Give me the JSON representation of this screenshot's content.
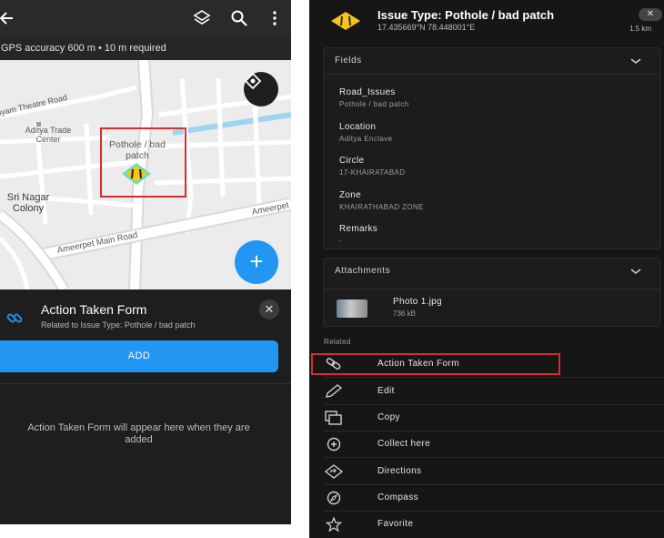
{
  "left": {
    "gps_text": "GPS accuracy 600 m • 10 m required",
    "map_labels": {
      "theatre_road": "iyam Theatre Road",
      "trade_center": "Aditya Trade Center",
      "sri_nagar": "Sri Nagar Colony",
      "ameerpet_main": "Ameerpet Main Road",
      "ameerpet": "Ameerpet"
    },
    "pin_label": "Pothole / bad patch",
    "fab_label": "+",
    "sheet": {
      "title": "Action Taken Form",
      "subtitle": "Related to Issue Type: Pothole / bad patch",
      "close": "✕",
      "add_label": "ADD",
      "empty_text": "Action Taken Form will appear here when they are added"
    }
  },
  "right": {
    "title": "Issue Type: Pothole / bad patch",
    "coords": "17.435669°N   78.448001°E",
    "close": "✕",
    "distance": "1.5 km",
    "fields_header": "Fields",
    "fields": [
      {
        "label": "Road_Issues",
        "value": "Pothole / bad patch"
      },
      {
        "label": "Location",
        "value": "Aditya Enclave"
      },
      {
        "label": "Circle",
        "value": "17-KHAIRATABAD"
      },
      {
        "label": "Zone",
        "value": "KHAIRATHABAD ZONE"
      },
      {
        "label": "Remarks",
        "value": "-"
      }
    ],
    "attachments_header": "Attachments",
    "attachment": {
      "name": "Photo 1.jpg",
      "size": "736 kB"
    },
    "related_label": "Related",
    "actions": [
      {
        "label": "Action Taken Form",
        "icon": "link-icon"
      },
      {
        "label": "Edit",
        "icon": "pencil-icon"
      },
      {
        "label": "Copy",
        "icon": "copy-icon"
      },
      {
        "label": "Collect here",
        "icon": "add-circle-icon"
      },
      {
        "label": "Directions",
        "icon": "directions-icon"
      },
      {
        "label": "Compass",
        "icon": "compass-icon"
      },
      {
        "label": "Favorite",
        "icon": "star-icon"
      }
    ]
  },
  "colors": {
    "accent": "#2196f3",
    "highlight": "#d42f2f",
    "marker": "#f5c518",
    "background_dark": "#161616"
  }
}
